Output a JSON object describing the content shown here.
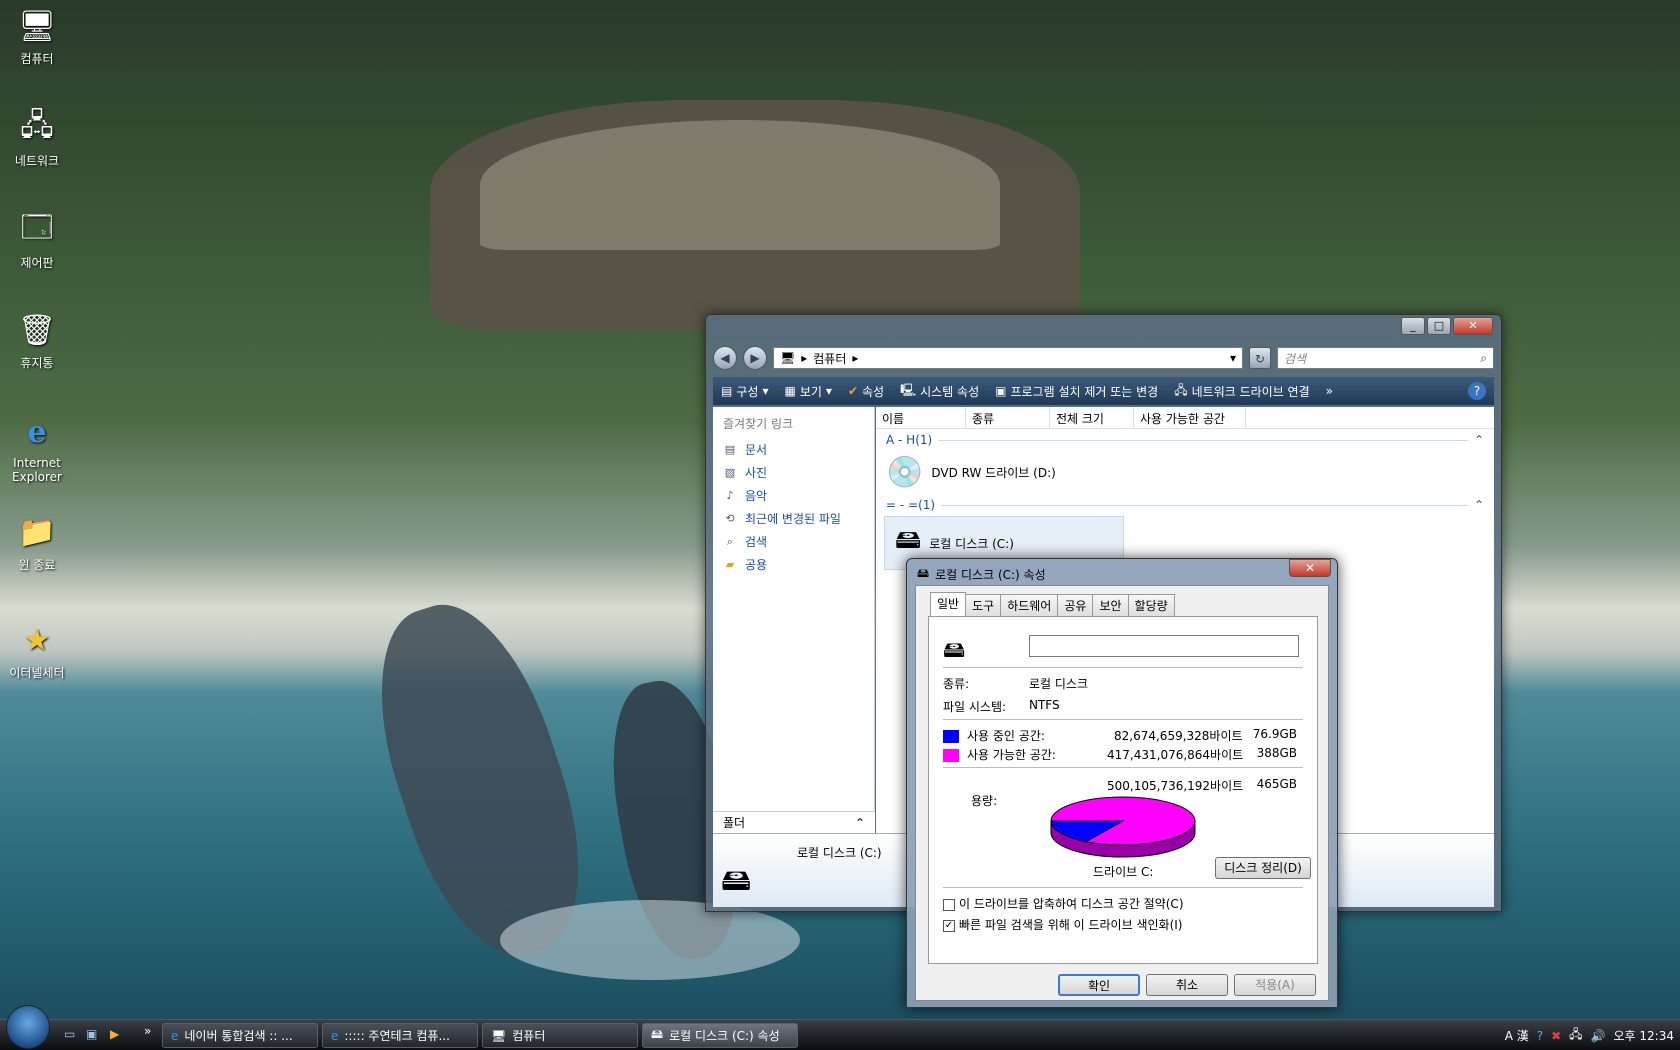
{
  "colors": {
    "used": "#0000ff",
    "free": "#ff00ff",
    "toolbar": "#2a4766",
    "link": "#1b4fa0"
  },
  "desktop_icons": [
    {
      "label": "컴퓨터",
      "icon": "computer-icon"
    },
    {
      "label": "네트워크",
      "icon": "network-icon"
    },
    {
      "label": "제어판",
      "icon": "control-panel-icon"
    },
    {
      "label": "휴지통",
      "icon": "recycle-bin-icon"
    },
    {
      "label": "Internet Explorer",
      "icon": "ie-icon"
    },
    {
      "label": "윈 종료",
      "icon": "shutdown-icon"
    },
    {
      "label": "이터넬세터",
      "icon": "star-shortcut-icon"
    }
  ],
  "explorer": {
    "address": "컴퓨터",
    "search_placeholder": "검색",
    "toolbar": [
      "구성",
      "보기",
      "속성",
      "시스템 속성",
      "프로그램 설치 제거 또는 변경",
      "네트워크 드라이브 연결"
    ],
    "favorites_header": "즐겨찾기 링크",
    "favorites": [
      "문서",
      "사진",
      "음악",
      "최근에 변경된 파일",
      "검색",
      "공용"
    ],
    "folders_label": "폴더",
    "columns": [
      "이름",
      "종류",
      "전체 크기",
      "사용 가능한 공간"
    ],
    "group1": "A - H(1)",
    "group2": "= - =(1)",
    "dvd_label": "DVD RW 드라이브 (D:)",
    "local_disk_label": "로컬 디스크 (C:)",
    "details_name": "로컬 디스크 (C:)"
  },
  "dialog": {
    "title": "로컬 디스크 (C:) 속성",
    "tabs": [
      "일반",
      "도구",
      "하드웨어",
      "공유",
      "보안",
      "할당량"
    ],
    "type_label": "종류:",
    "type_value": "로컬 디스크",
    "fs_label": "파일 시스템:",
    "fs_value": "NTFS",
    "used_label": "사용 중인 공간:",
    "used_bytes": "82,674,659,328바이트",
    "used_gb": "76.9GB",
    "free_label": "사용 가능한 공간:",
    "free_bytes": "417,431,076,864바이트",
    "free_gb": "388GB",
    "cap_label": "용량:",
    "cap_bytes": "500,105,736,192바이트",
    "cap_gb": "465GB",
    "drive_label": "드라이브 C:",
    "cleanup": "디스크 정리(D)",
    "compress": "이 드라이브를 압축하여 디스크 공간 절약(C)",
    "index": "빠른 파일 검색을 위해 이 드라이브 색인화(I)",
    "ok": "확인",
    "cancel": "취소",
    "apply": "적용(A)",
    "used_fraction": 0.165
  },
  "taskbar": {
    "tasks": [
      "네이버 통합검색 :: ...",
      "::::: 주연테크 컴퓨...",
      "컴퓨터",
      "로컬 디스크 (C:) 속성"
    ],
    "tray_lang": "A 漢",
    "clock": "오후 12:34"
  }
}
